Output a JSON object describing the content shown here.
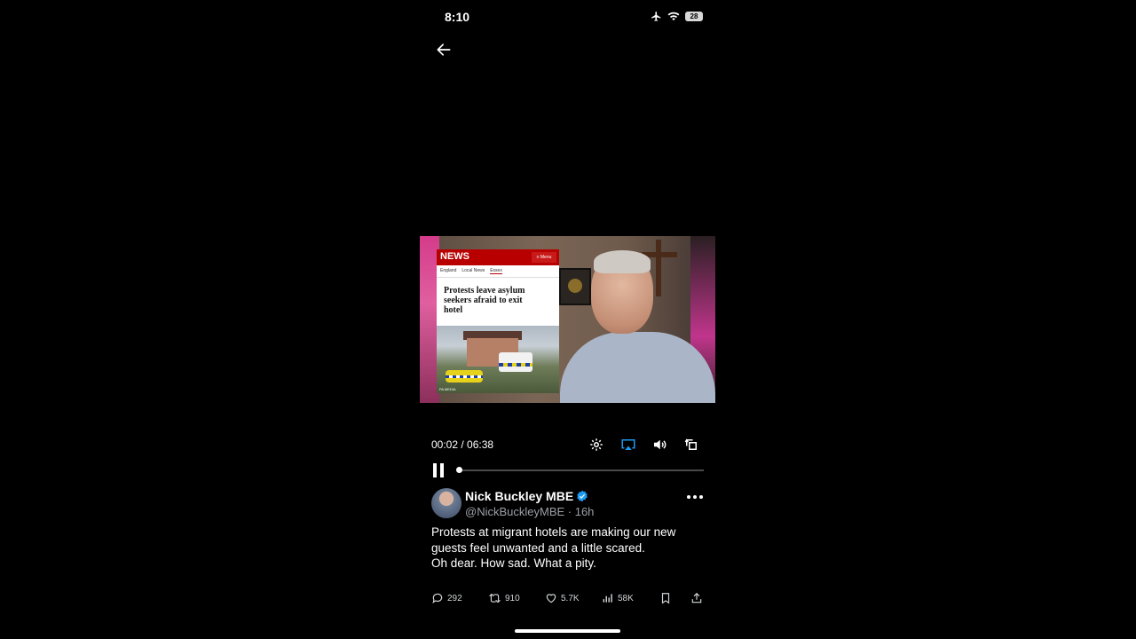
{
  "status_bar": {
    "time": "8:10",
    "battery_level": "28",
    "icons": [
      "airplane-icon",
      "wifi-icon",
      "battery-icon"
    ]
  },
  "video": {
    "news_overlay": {
      "brand": "NEWS",
      "menu_label": "≡ Menu",
      "breadcrumbs": [
        "England",
        "Local News",
        "Essex"
      ],
      "headline_lines": [
        "Protests leave asylum",
        "seekers afraid to exit",
        "hotel"
      ],
      "photo_credit": "PA MEDIA"
    },
    "timecode": "00:02 / 06:38",
    "progress_fraction": 0.005,
    "controls": [
      "settings-icon",
      "airplay-icon",
      "volume-icon",
      "rotate-icon"
    ]
  },
  "tweet": {
    "author_name": "Nick Buckley MBE",
    "handle_time": "@NickBuckleyMBE · 16h",
    "text_lines": [
      "Protests at migrant hotels are making our new",
      "guests feel unwanted and a little scared.",
      "Oh dear. How sad. What a pity."
    ],
    "stats": {
      "replies": "292",
      "reposts": "910",
      "likes": "5.7K",
      "views": "58K"
    }
  },
  "colors": {
    "background": "#000000",
    "verified_blue": "#1d9bf0",
    "airplay_blue": "#1d9bf0",
    "news_red": "#b80000"
  }
}
